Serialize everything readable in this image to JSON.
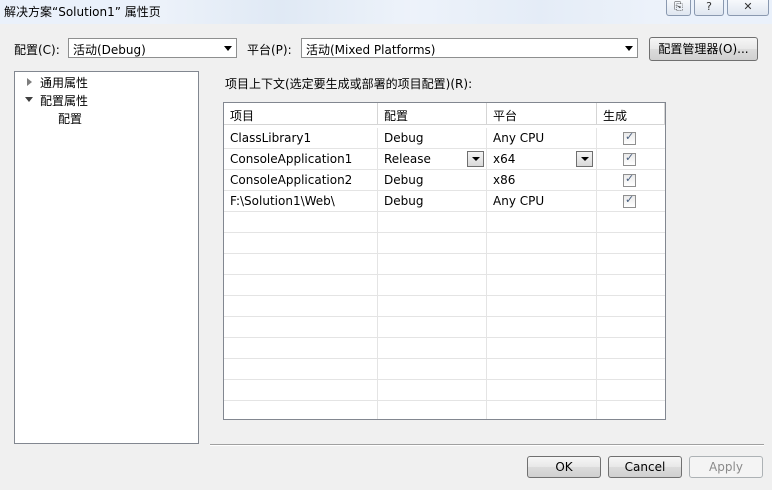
{
  "window": {
    "title": "解决方案“Solution1” 属性页",
    "titlebar_buttons": [
      "⎘",
      "?",
      "✕"
    ]
  },
  "toolbar": {
    "config_label": "配置(C):",
    "config_value": "活动(Debug)",
    "platform_label": "平台(P):",
    "platform_value": "活动(Mixed Platforms)",
    "config_manager_button": "配置管理器(O)..."
  },
  "tree": {
    "items": [
      {
        "label": "通用属性",
        "expanded": false
      },
      {
        "label": "配置属性",
        "expanded": true
      },
      {
        "label": "配置",
        "selected": true
      }
    ]
  },
  "grid": {
    "caption": "项目上下文(选定要生成或部署的项目配置)(R):",
    "columns": [
      "项目",
      "配置",
      "平台",
      "生成"
    ],
    "rows": [
      {
        "project": "ClassLibrary1",
        "config": "Debug",
        "platform": "Any CPU",
        "build": true
      },
      {
        "project": "ConsoleApplication1",
        "config": "Release",
        "platform": "x64",
        "build": true
      },
      {
        "project": "ConsoleApplication2",
        "config": "Debug",
        "platform": "x86",
        "build": true
      },
      {
        "project": "F:\\Solution1\\Web\\",
        "config": "Debug",
        "platform": "Any CPU",
        "build": true
      }
    ]
  },
  "footer": {
    "ok": "OK",
    "cancel": "Cancel",
    "apply": "Apply"
  }
}
